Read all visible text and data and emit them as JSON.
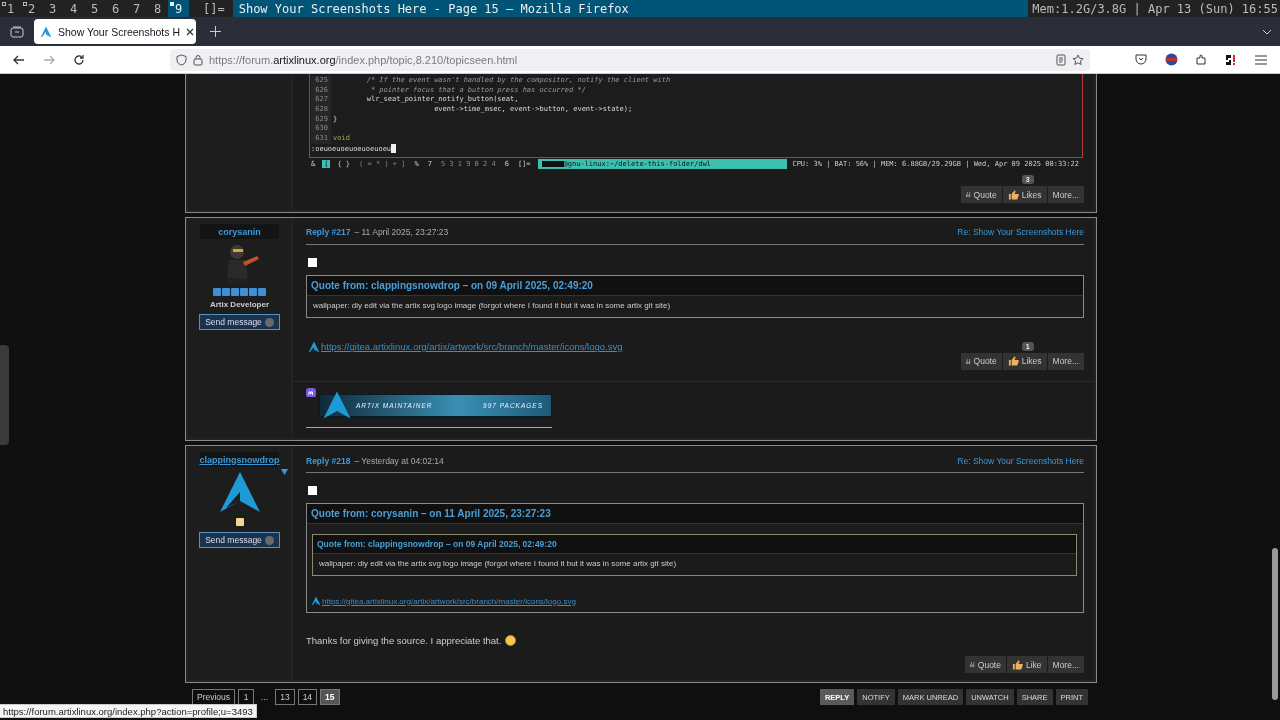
{
  "desktop_bar": {
    "workspaces": [
      {
        "label": "1",
        "occupied": true,
        "selected": false
      },
      {
        "label": "2",
        "occupied": true,
        "selected": false
      },
      {
        "label": "3",
        "occupied": false,
        "selected": false
      },
      {
        "label": "4",
        "occupied": false,
        "selected": false
      },
      {
        "label": "5",
        "occupied": false,
        "selected": false
      },
      {
        "label": "6",
        "occupied": false,
        "selected": false
      },
      {
        "label": "7",
        "occupied": false,
        "selected": false
      },
      {
        "label": "8",
        "occupied": false,
        "selected": false
      },
      {
        "label": "9",
        "occupied": true,
        "selected": true
      }
    ],
    "layout": "[]=",
    "window_title": "Show Your Screenshots Here - Page 15 — Mozilla Firefox",
    "status": "Mem:1.2G/3.8G | Apr 13 (Sun) 16:55"
  },
  "browser": {
    "tabs": [
      {
        "title": "Show Your Screenshots H",
        "selected": true
      }
    ],
    "url": {
      "prefix": "https://forum.",
      "domain": "artixlinux.org",
      "path": "/index.php/topic,8.210/topicseen.html"
    }
  },
  "posts": [
    {
      "kind": "code",
      "code_shot": {
        "lines": [
          {
            "number": "625",
            "text": "        /* If the event wasn't handled by the compositor, notify the client with",
            "kind": "comment"
          },
          {
            "number": "626",
            "text": "         * pointer focus that a button press has occurred */",
            "kind": "comment"
          },
          {
            "number": "627",
            "text": "        wlr_seat_pointer_notify_button(seat,",
            "kind": "code"
          },
          {
            "number": "628",
            "text": "                        event->time_msec, event->button, event->state);",
            "kind": "code"
          },
          {
            "number": "629",
            "text": "}",
            "kind": "code"
          },
          {
            "number": "630",
            "kind": "code"
          },
          {
            "number": "631",
            "text": "void",
            "kind": "keyword"
          }
        ],
        "command": ":oeuoeuoeuoeuoeuoeu",
        "tags": [
          {
            "label": "&",
            "kind": "plain"
          },
          {
            "label": "[",
            "kind": "active"
          },
          {
            "label": "{ }",
            "kind": "plain"
          },
          {
            "label": "( = * ) + ]",
            "kind": "dim"
          },
          {
            "label": "%",
            "kind": "plain"
          },
          {
            "label": "7",
            "kind": "plain"
          },
          {
            "label": "5 3 1 9 0 2 4",
            "kind": "dim"
          },
          {
            "label": "6",
            "kind": "plain"
          },
          {
            "label": "[]=",
            "kind": "plain"
          }
        ],
        "title": "@gnu-linux:~/delete-this-folder/dwl",
        "info": "CPU: 3% | BAT: 56% | MEM: 6.88GB/29.29GB | Wed, Apr 09 2025 00:33:22"
      },
      "buttons": [
        {
          "label": "Quote",
          "kind": "quote"
        },
        {
          "label": "Likes",
          "kind": "like",
          "count": "3"
        },
        {
          "label": "More...",
          "kind": "more"
        }
      ]
    },
    {
      "kind": "reply",
      "author": {
        "name": "corysanin",
        "hover": false,
        "avatar": {
          "kind": "figure"
        },
        "ranks": [
          {
            "color": "#3d8fd6"
          },
          {
            "color": "#3d8fd6"
          },
          {
            "color": "#3d8fd6"
          },
          {
            "color": "#3d8fd6"
          },
          {
            "color": "#3d8fd6"
          },
          {
            "color": "#3d8fd6"
          }
        ],
        "title": "Artix Developer",
        "send": "Send message",
        "online": false
      },
      "reply": "Reply #217",
      "date": "– 11 April 2025, 23:27:23",
      "subject": "Re: Show Your Screenshots Here",
      "checkbox": {
        "checked": false
      },
      "quote": {
        "header": "Quote from: clappingsnowdrop – on 09 April 2025, 02:49:20",
        "text": "wallpaper: diy edit via the artix svg logo image (forgot where I found it but it was in some artix git site)"
      },
      "link": "https://gitea.artixlinux.org/artix/artwork/src/branch/master/icons/logo.svg",
      "buttons": [
        {
          "label": "Quote",
          "kind": "quote"
        },
        {
          "label": "Likes",
          "kind": "like",
          "count": "1"
        },
        {
          "label": "More...",
          "kind": "more"
        }
      ],
      "signature": {
        "banner_left": "ARTIX MAINTAINER",
        "banner_right": "997 PACKAGES"
      }
    },
    {
      "kind": "reply",
      "author": {
        "name": "clappingsnowdrop",
        "hover": true,
        "avatar": {
          "kind": "logo"
        },
        "ranks": [
          {
            "color": "#f2d98a"
          }
        ],
        "send": "Send message",
        "online": false
      },
      "reply": "Reply #218",
      "date": "– Yesterday at 04:02:14",
      "subject": "Re: Show Your Screenshots Here",
      "checkbox": {
        "checked": false
      },
      "quote": {
        "header": "Quote from: corysanin – on 11 April 2025, 23:27:23",
        "quote": {
          "header": "Quote from: clappingsnowdrop – on 09 April 2025, 02:49:20",
          "text": "wallpaper: diy edit via the artix svg logo image (forgot where I found it but it was in some artix git site)"
        },
        "link": "https://gitea.artixlinux.org/artix/artwork/src/branch/master/icons/logo.svg"
      },
      "body": "Thanks for giving the source. I appreciate that.",
      "buttons": [
        {
          "label": "Quote",
          "kind": "quote"
        },
        {
          "label": "Like",
          "kind": "like"
        },
        {
          "label": "More...",
          "kind": "more"
        }
      ]
    }
  ],
  "pagination": [
    {
      "label": "Previous",
      "selected": false
    },
    {
      "label": "1",
      "selected": false
    },
    {
      "label": "...",
      "kind": "gap",
      "selected": false
    },
    {
      "label": "13",
      "selected": false
    },
    {
      "label": "14",
      "selected": false
    },
    {
      "label": "15",
      "selected": true
    }
  ],
  "actions": [
    {
      "label": "REPLY",
      "selected": true
    },
    {
      "label": "NOTIFY",
      "selected": false
    },
    {
      "label": "MARK UNREAD",
      "selected": false
    },
    {
      "label": "UNWATCH",
      "selected": false
    },
    {
      "label": "SHARE",
      "selected": false
    },
    {
      "label": "PRINT",
      "selected": false
    }
  ],
  "status_link": "https://forum.artixlinux.org/index.php?action=profile;u=3493"
}
